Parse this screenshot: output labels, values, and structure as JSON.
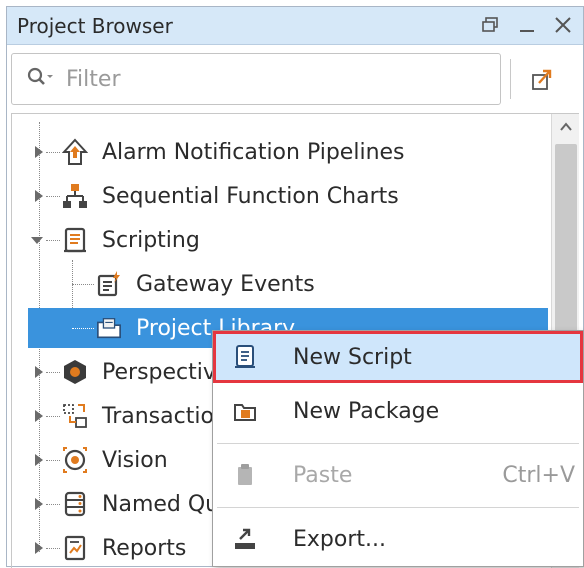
{
  "panel": {
    "title": "Project Browser",
    "buttons": [
      "restore-icon",
      "minimize-icon",
      "close-icon"
    ]
  },
  "filter": {
    "placeholder": "Filter"
  },
  "tree": {
    "items": [
      {
        "label": "Alarm Notification Pipelines",
        "icon": "alarm-pipeline-icon",
        "expanded": false
      },
      {
        "label": "Sequential Function Charts",
        "icon": "sfc-icon",
        "expanded": false
      },
      {
        "label": "Scripting",
        "icon": "scripting-icon",
        "expanded": true
      },
      {
        "label": "Gateway Events",
        "icon": "gateway-events-icon",
        "child": true
      },
      {
        "label": "Project Library",
        "icon": "project-library-icon",
        "child": true,
        "selected": true
      },
      {
        "label": "Perspective",
        "icon": "perspective-icon",
        "expanded": false
      },
      {
        "label": "Transactions",
        "icon": "transaction-icon",
        "expanded": false
      },
      {
        "label": "Vision",
        "icon": "vision-icon",
        "expanded": false
      },
      {
        "label": "Named Queries",
        "icon": "named-query-icon",
        "expanded": false
      },
      {
        "label": "Reports",
        "icon": "reports-icon",
        "expanded": false
      }
    ]
  },
  "context_menu": {
    "items": [
      {
        "label": "New Script",
        "icon": "new-script-icon",
        "highlighted": true
      },
      {
        "label": "New Package",
        "icon": "new-package-icon"
      },
      {
        "label": "Paste",
        "icon": "paste-icon",
        "shortcut": "Ctrl+V",
        "disabled": true
      },
      {
        "label": "Export...",
        "icon": "export-icon"
      }
    ]
  },
  "colors": {
    "titlebar": "#d6e8f8",
    "selection": "#3a93dd",
    "menu_highlight": "#cfe6fb",
    "highlight_border": "#e5363f",
    "accent_orange": "#e07b1f"
  }
}
